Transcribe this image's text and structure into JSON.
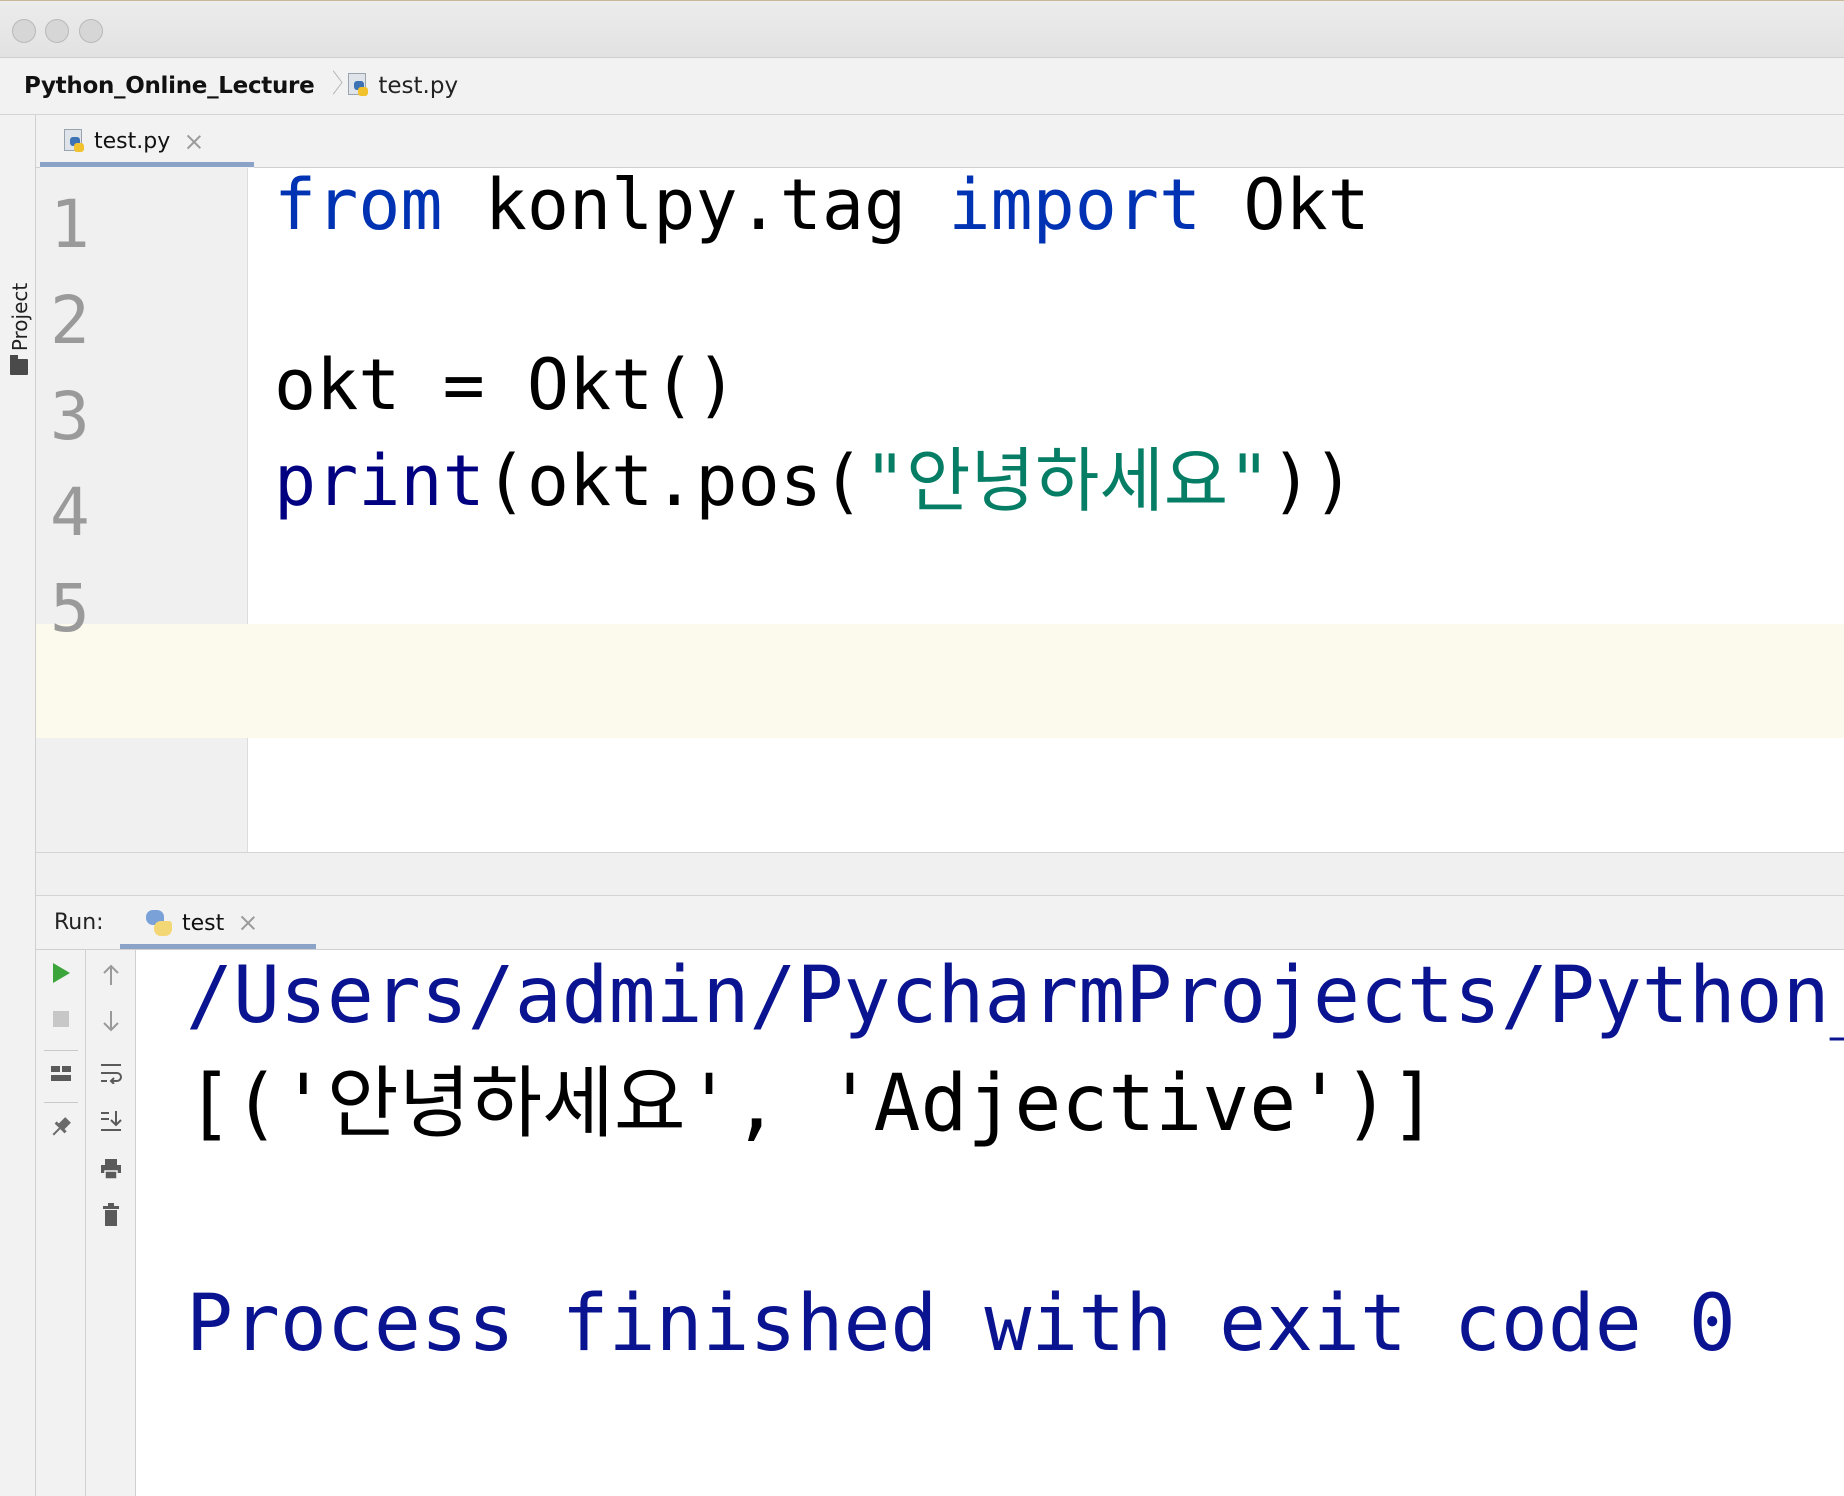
{
  "breadcrumb": {
    "project": "Python_Online_Lecture",
    "file": "test.py"
  },
  "left_strip": {
    "project_tab_label": "1: Project"
  },
  "editor_tabs": [
    {
      "label": "test.py",
      "active": true
    }
  ],
  "editor": {
    "line_numbers": [
      "1",
      "2",
      "3",
      "4",
      "5"
    ],
    "current_line": 5,
    "code": {
      "line1": {
        "kw_from": "from",
        "module": " konlpy.tag ",
        "kw_import": "import",
        "name": " Okt"
      },
      "line3": {
        "text": "okt = Okt()"
      },
      "line4": {
        "func": "print",
        "open": "(okt.pos(",
        "string": "\"안녕하세요\"",
        "close": "))"
      }
    }
  },
  "run_window": {
    "label": "Run:",
    "tab_label": "test",
    "toolbar_left": [
      "run-icon",
      "stop-icon",
      "layout-icon",
      "pin-icon"
    ],
    "toolbar_right": [
      "up-arrow-icon",
      "down-arrow-icon",
      "soft-wrap-icon",
      "scroll-to-end-icon",
      "print-icon",
      "trash-icon"
    ],
    "console": {
      "path_line": "/Users/admin/PycharmProjects/Python_",
      "output_line": "[('안녕하세요', 'Adjective')]",
      "exit_line": "Process finished with exit code 0"
    }
  },
  "colors": {
    "keyword": "#0033b3",
    "string": "#067d65",
    "console_path": "#0b1490",
    "current_line_bg": "#fcfaed",
    "tab_underline": "#8aa3c7",
    "run_green": "#3ba53b"
  }
}
